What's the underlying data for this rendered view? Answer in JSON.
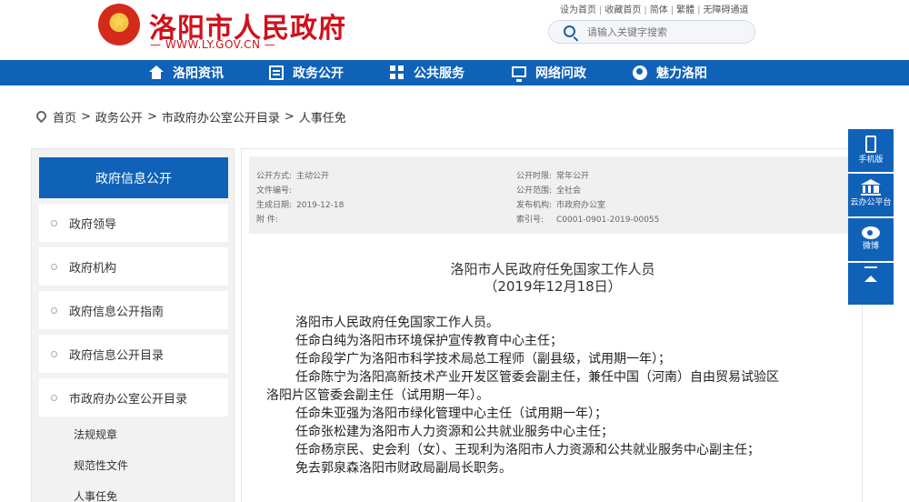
{
  "header": {
    "site_title": "洛阳市人民政府",
    "site_url": "— WWW.LY.GOV.CN —",
    "top_links": [
      "设为首页",
      "收藏首页",
      "简体",
      "繁體",
      "无障碍通道"
    ],
    "search_placeholder": "请输入关键字搜索"
  },
  "nav": {
    "items": [
      {
        "label": "洛阳资讯",
        "icon": "home-icon"
      },
      {
        "label": "政务公开",
        "icon": "document-icon"
      },
      {
        "label": "公共服务",
        "icon": "grid-icon"
      },
      {
        "label": "网络问政",
        "icon": "monitor-icon"
      },
      {
        "label": "魅力洛阳",
        "icon": "globe-icon"
      }
    ]
  },
  "breadcrumb": {
    "items": [
      "首页",
      "政务公开",
      "市政府办公室公开目录",
      "人事任免"
    ],
    "separator": ">"
  },
  "sidebar": {
    "title": "政府信息公开",
    "items": [
      "政府领导",
      "政府机构",
      "政府信息公开指南",
      "政府信息公开目录",
      "市政府办公室公开目录"
    ],
    "sub_items": [
      "法规规章",
      "规范性文件",
      "人事任免"
    ]
  },
  "meta": {
    "open_mode_label": "公开方式:",
    "open_mode": "主动公开",
    "doc_no_label": "文件编号:",
    "doc_no": "",
    "created_label": "生成日期:",
    "created": "2019-12-18",
    "attach_label": "附    件:",
    "attach": "",
    "open_time_label": "公开时限:",
    "open_time": "常年公开",
    "scope_label": "公开范围:",
    "scope": "全社会",
    "org_label": "发布机构:",
    "org": "市政府办公室",
    "index_label": "索引号:",
    "index": "C0001-0901-2019-00055"
  },
  "article": {
    "title": "洛阳市人民政府任免国家工作人员",
    "date": "（2019年12月18日）",
    "lines": [
      "洛阳市人民政府任免国家工作人员。",
      "任命白纯为洛阳市环境保护宣传教育中心主任；",
      "任命段学广为洛阳市科学技术局总工程师（副县级，试用期一年）；",
      "任命陈宁为洛阳高新技术产业开发区管委会副主任，兼任中国（河南）自由贸易试验区",
      "洛阳片区管委会副主任（试用期一年）。",
      "任命朱亚强为洛阳市绿化管理中心主任（试用期一年）；",
      "任命张松建为洛阳市人力资源和公共就业服务中心主任；",
      "任命杨京民、史会利（女）、王现利为洛阳市人力资源和公共就业服务中心副主任；",
      "免去郭泉森洛阳市财政局副局长职务。"
    ]
  },
  "float_bar": {
    "mobile_label": "手机版",
    "cloud_label": "云办公平台",
    "weibo_label": "微博"
  },
  "colors": {
    "brand_blue": "#1062b8",
    "brand_red": "#d0111b"
  }
}
